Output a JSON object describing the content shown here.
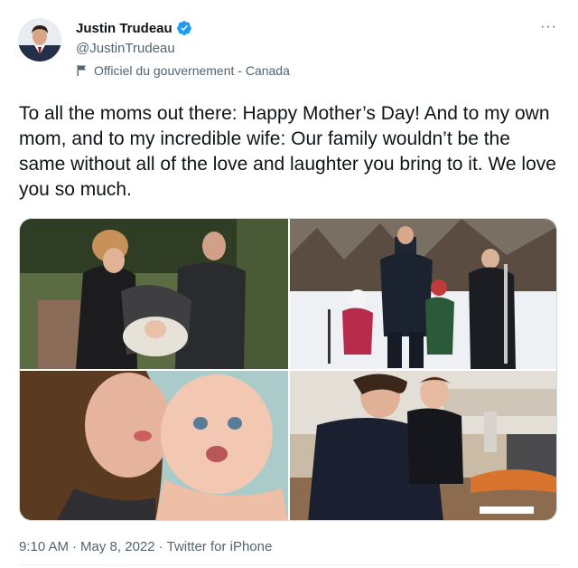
{
  "author": {
    "display_name": "Justin Trudeau",
    "handle": "@JustinTrudeau",
    "verified": true,
    "label": "Officiel du gouvernement - Canada"
  },
  "tweet": {
    "text": "To all the moms out there: Happy Mother’s Day! And to my own mom, and to my incredible wife: Our family wouldn’t be the same without all of the love and laughter you bring to it. We love you so much.",
    "time": "9:10 AM",
    "date": "May 8, 2022",
    "separator": "·",
    "source": "Twitter for iPhone"
  },
  "more_label": "···",
  "colors": {
    "text": "#0f1419",
    "secondary": "#536471",
    "verified_blue": "#1d9bf0",
    "border": "#cfd9de"
  },
  "icons": {
    "verified": "verified-badge-icon",
    "label": "flag-icon",
    "more": "more-options-icon"
  }
}
